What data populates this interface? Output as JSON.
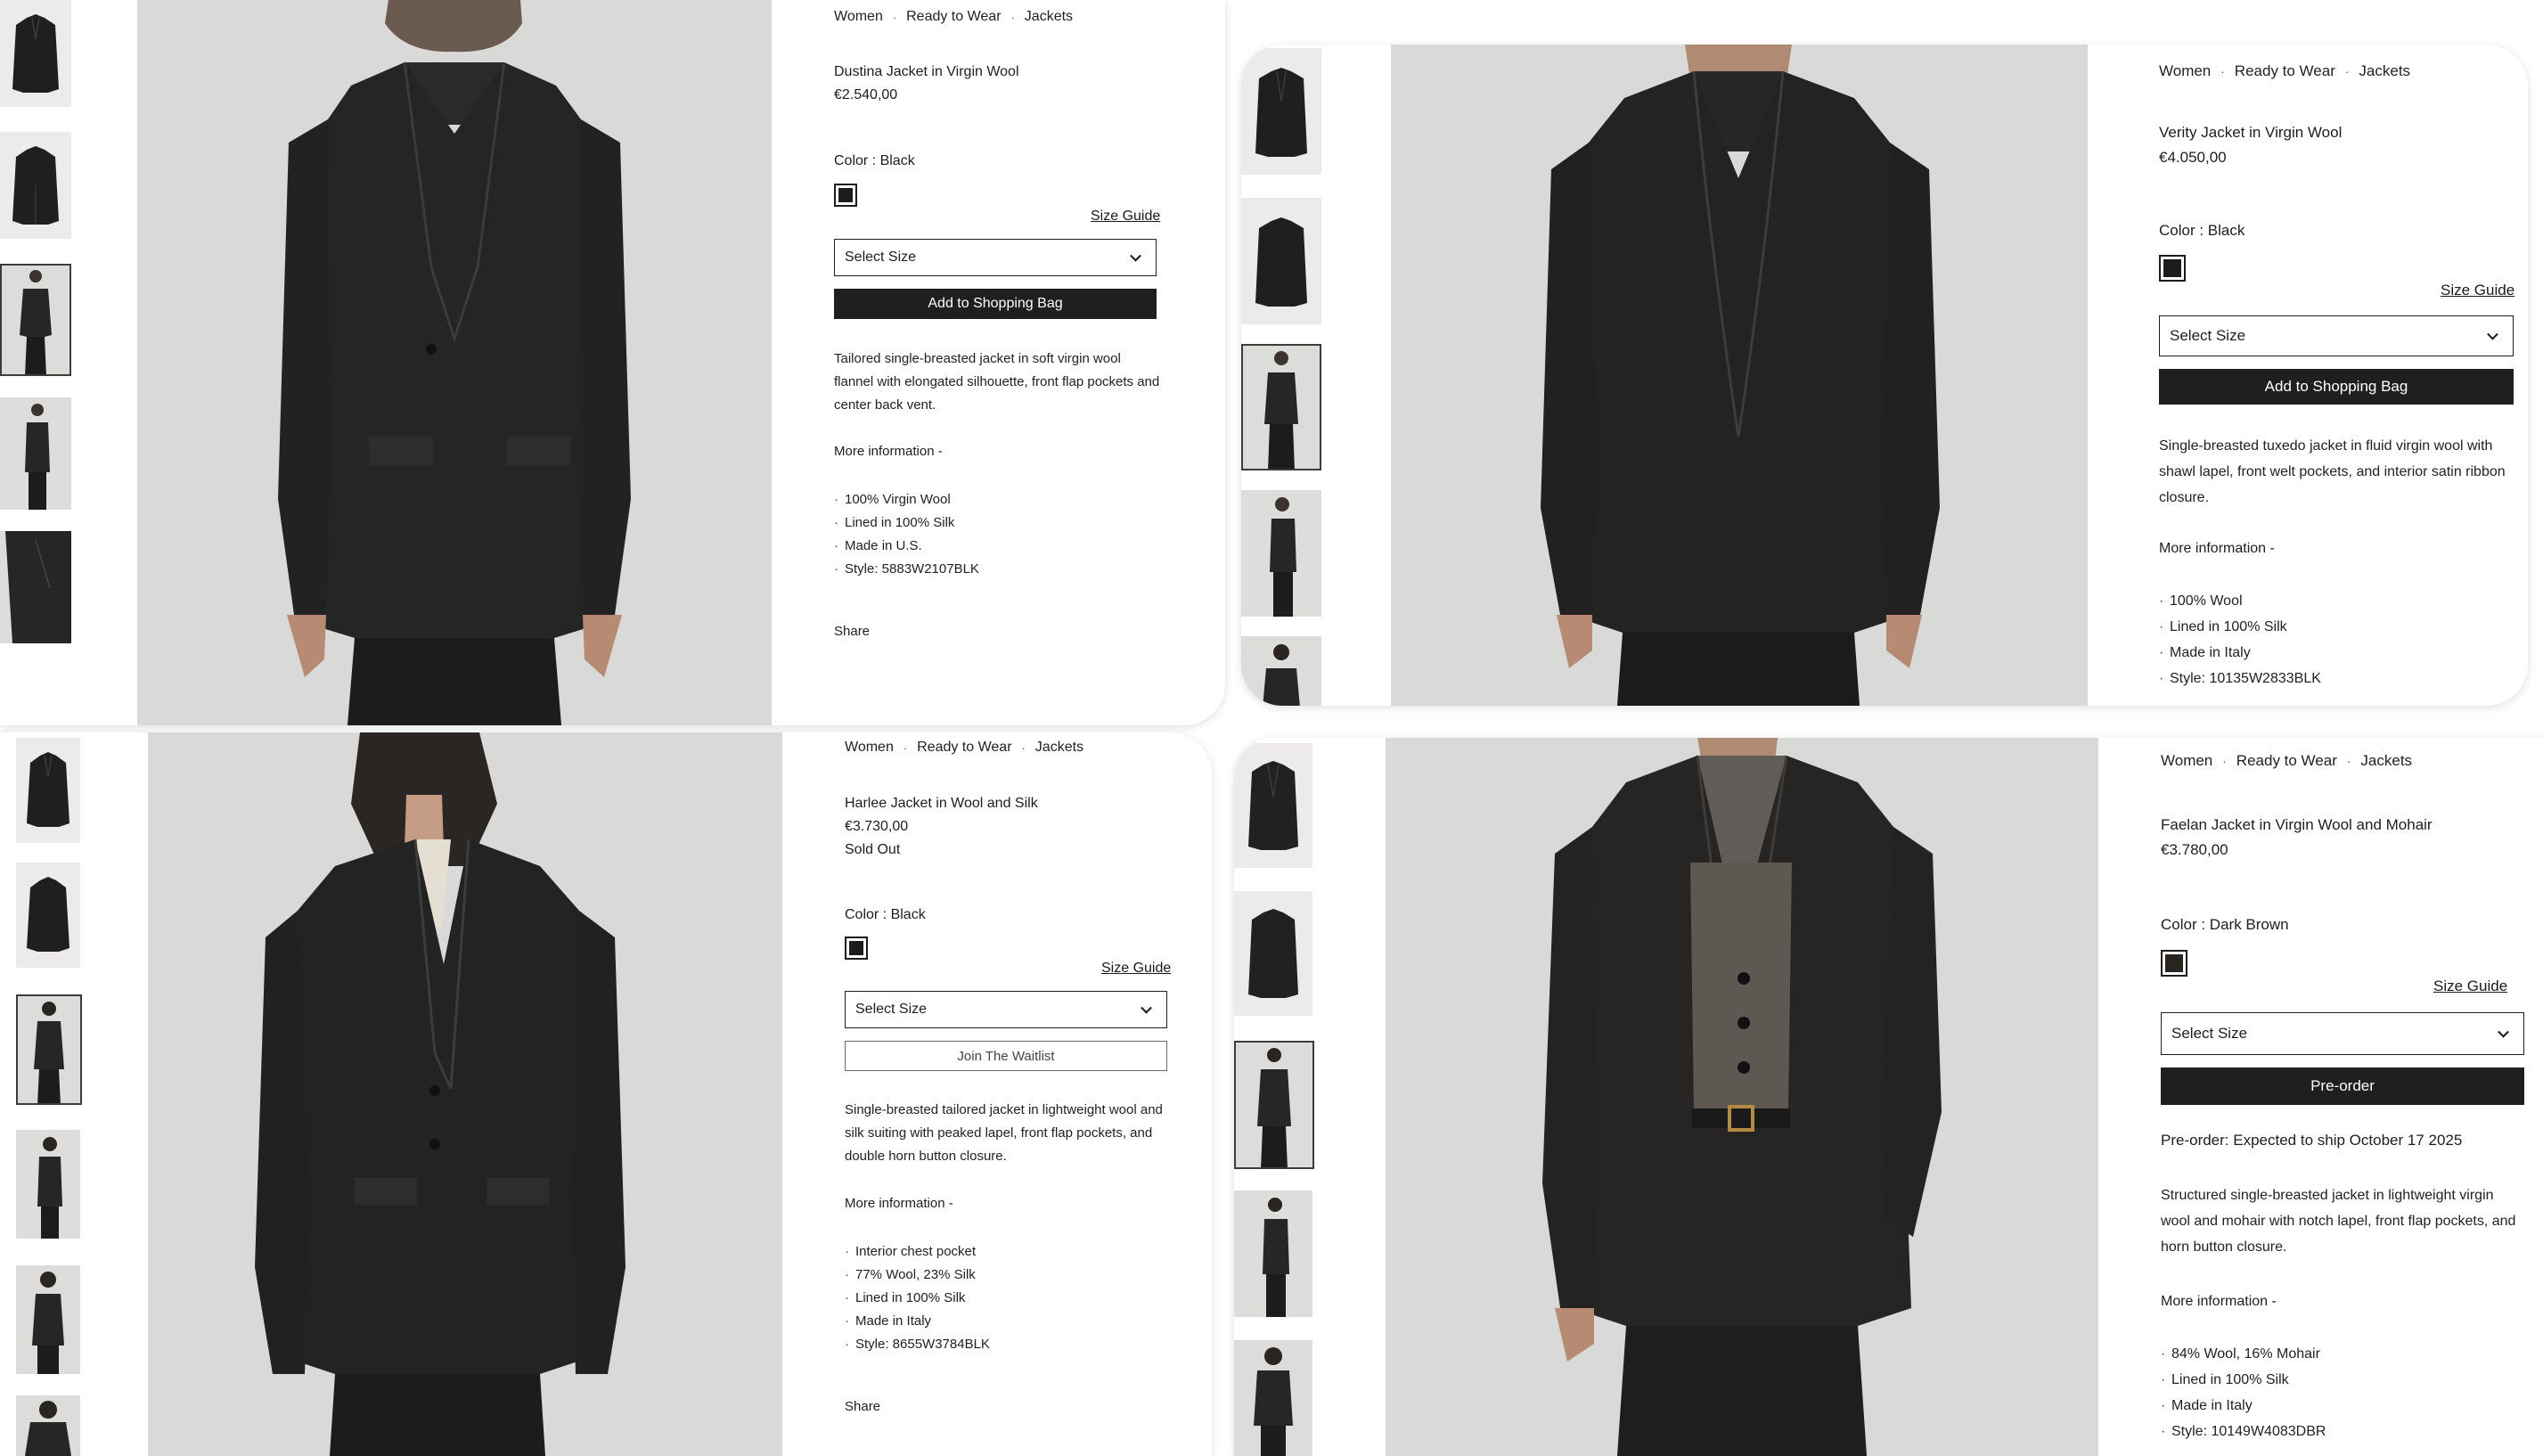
{
  "breadcrumb": [
    "Women",
    "Ready to Wear",
    "Jackets"
  ],
  "breadcrumb_separator": "·",
  "color_prefix": "Color : ",
  "size_guide_label": "Size Guide",
  "select_size_label": "Select Size",
  "more_info_label": "More information -",
  "bullet_glyph": "·",
  "share_label": "Share",
  "panels": [
    {
      "name": "Dustina Jacket in Virgin Wool",
      "price": "€2.540,00",
      "color": "Black",
      "primary_button": "Add to Shopping Bag",
      "description": "Tailored single-breasted jacket in soft virgin wool flannel with elongated silhouette, front flap pockets and center back vent.",
      "details": [
        "100% Virgin Wool",
        "Lined in 100% Silk",
        "Made in U.S.",
        "Style: 5883W2107BLK"
      ]
    },
    {
      "name": "Verity Jacket in Virgin Wool",
      "price": "€4.050,00",
      "color": "Black",
      "primary_button": "Add to Shopping Bag",
      "description": "Single-breasted tuxedo jacket in fluid virgin wool with shawl lapel, front welt pockets, and interior satin ribbon closure.",
      "details": [
        "100% Wool",
        "Lined in 100% Silk",
        "Made in Italy",
        "Style: 10135W2833BLK"
      ]
    },
    {
      "name": "Harlee Jacket in Wool and Silk",
      "price": "€3.730,00",
      "status": "Sold Out",
      "color": "Black",
      "secondary_button": "Join The Waitlist",
      "description": "Single-breasted tailored jacket in lightweight wool and silk suiting with peaked lapel, front flap pockets, and double horn button closure.",
      "details": [
        "Interior chest pocket",
        "77% Wool, 23% Silk",
        "Lined in 100% Silk",
        "Made in Italy",
        "Style: 8655W3784BLK"
      ]
    },
    {
      "name": "Faelan Jacket in Virgin Wool and Mohair",
      "price": "€3.780,00",
      "color": "Dark Brown",
      "primary_button": "Pre-order",
      "preorder_note": "Pre-order: Expected to ship October 17 2025",
      "description": "Structured single-breasted jacket in lightweight virgin wool and mohair with notch lapel, front flap pockets, and horn button closure.",
      "details": [
        "84% Wool, 16% Mohair",
        "Lined in 100% Silk",
        "Made in Italy",
        "Style: 10149W4083DBR"
      ]
    }
  ],
  "colors": {
    "primary_button_bg": "#1f1f1f",
    "primary_button_text": "#ffffff",
    "jacket": "#242424",
    "photo_background": "#d8d8d7"
  }
}
